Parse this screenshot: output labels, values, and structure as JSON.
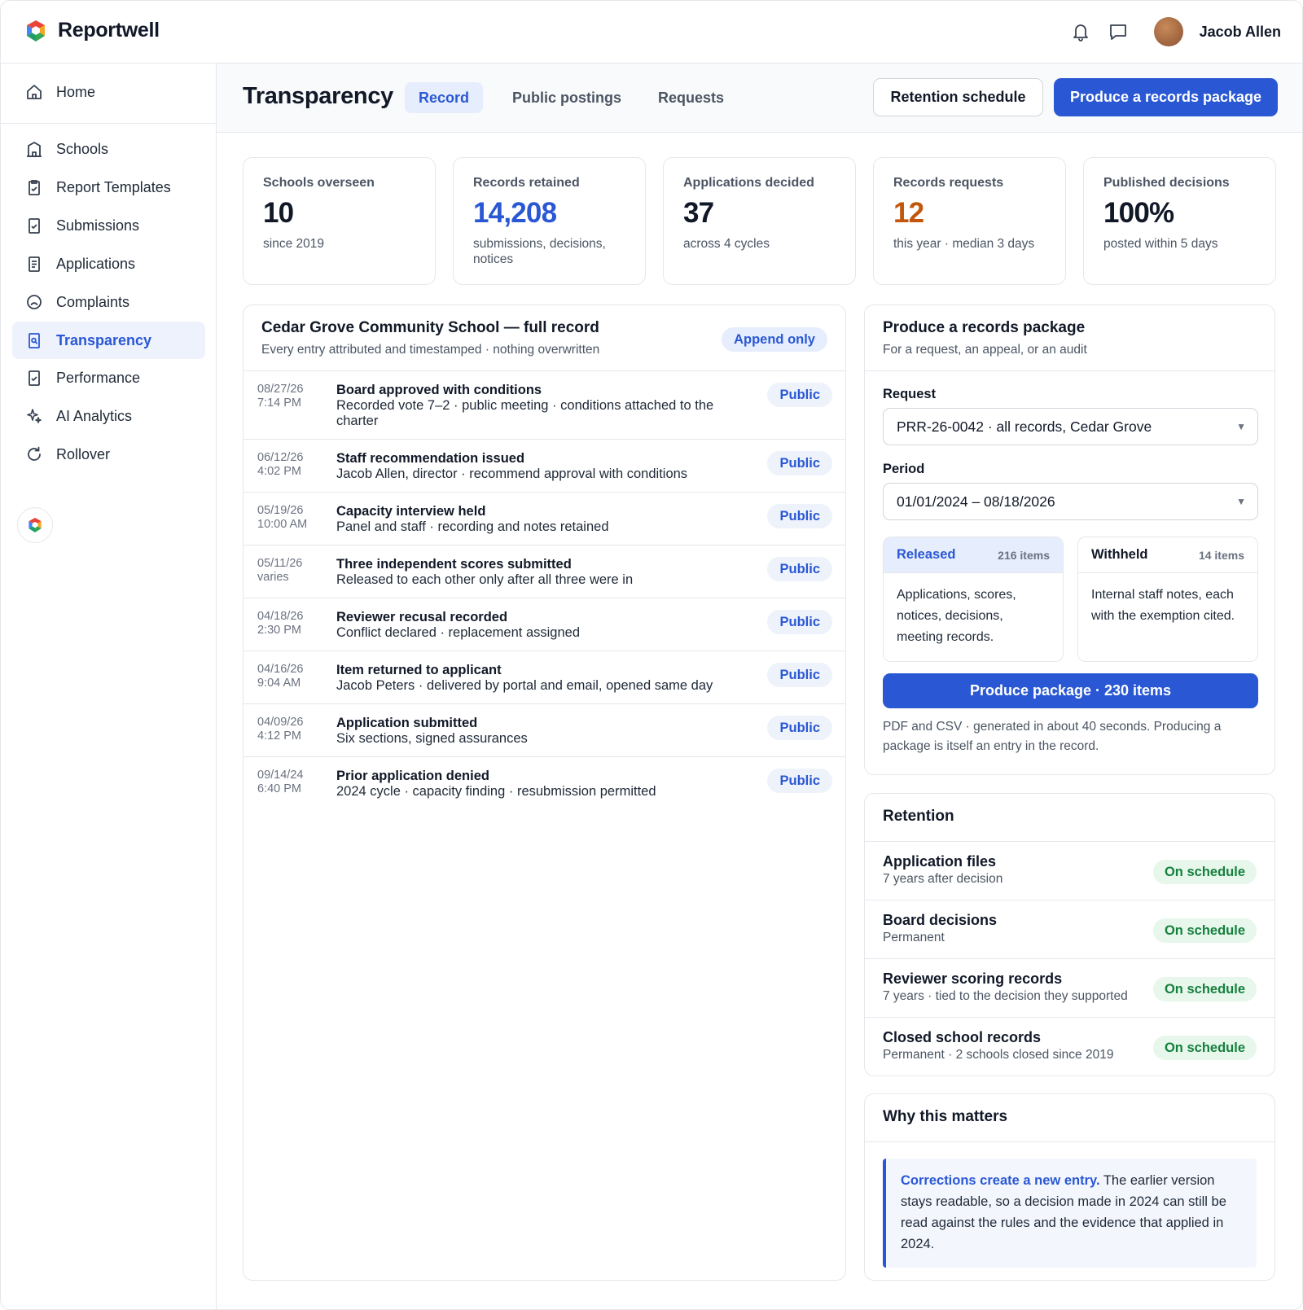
{
  "app": {
    "name": "Reportwell"
  },
  "user": {
    "name": "Jacob Allen"
  },
  "sidebar": {
    "items": [
      {
        "label": "Home",
        "icon": "home-icon"
      },
      {
        "label": "Schools",
        "icon": "building-icon"
      },
      {
        "label": "Report Templates",
        "icon": "clipboard-icon"
      },
      {
        "label": "Submissions",
        "icon": "checkbox-doc-icon"
      },
      {
        "label": "Applications",
        "icon": "document-icon"
      },
      {
        "label": "Complaints",
        "icon": "frown-icon"
      },
      {
        "label": "Transparency",
        "icon": "search-doc-icon",
        "active": true
      },
      {
        "label": "Performance",
        "icon": "checkbox-doc-icon"
      },
      {
        "label": "AI Analytics",
        "icon": "sparkle-icon"
      },
      {
        "label": "Rollover",
        "icon": "refresh-icon"
      }
    ]
  },
  "header": {
    "title": "Transparency",
    "tabs": [
      {
        "label": "Record",
        "active": true
      },
      {
        "label": "Public postings"
      },
      {
        "label": "Requests"
      }
    ],
    "secondary_button": "Retention schedule",
    "primary_button": "Produce a records package"
  },
  "stats": [
    {
      "label": "Schools overseen",
      "value": "10",
      "sub": "since 2019",
      "tone": "default"
    },
    {
      "label": "Records retained",
      "value": "14,208",
      "sub": "submissions, decisions, notices",
      "tone": "blue"
    },
    {
      "label": "Applications decided",
      "value": "37",
      "sub": "across 4 cycles",
      "tone": "default"
    },
    {
      "label": "Records requests",
      "value": "12",
      "sub": "this year · median 3 days",
      "tone": "orange"
    },
    {
      "label": "Published decisions",
      "value": "100%",
      "sub": "posted within 5 days",
      "tone": "default"
    }
  ],
  "record": {
    "title": "Cedar Grove Community School — full record",
    "subtitle": "Every entry attributed and timestamped · nothing overwritten",
    "badge": "Append only",
    "entries": [
      {
        "date": "08/27/26",
        "time": "7:14 PM",
        "title": "Board approved with conditions",
        "desc": "Recorded vote 7–2 · public meeting · conditions attached to the charter",
        "badge": "Public"
      },
      {
        "date": "06/12/26",
        "time": "4:02 PM",
        "title": "Staff recommendation issued",
        "desc": "Jacob Allen, director · recommend approval with conditions",
        "badge": "Public"
      },
      {
        "date": "05/19/26",
        "time": "10:00 AM",
        "title": "Capacity interview held",
        "desc": "Panel and staff · recording and notes retained",
        "badge": "Public"
      },
      {
        "date": "05/11/26",
        "time": "varies",
        "title": "Three independent scores submitted",
        "desc": "Released to each other only after all three were in",
        "badge": "Public"
      },
      {
        "date": "04/18/26",
        "time": "2:30 PM",
        "title": "Reviewer recusal recorded",
        "desc": "Conflict declared · replacement assigned",
        "badge": "Public"
      },
      {
        "date": "04/16/26",
        "time": "9:04 AM",
        "title": "Item returned to applicant",
        "desc": "Jacob Peters · delivered by portal and email, opened same day",
        "badge": "Public"
      },
      {
        "date": "04/09/26",
        "time": "4:12 PM",
        "title": "Application submitted",
        "desc": "Six sections, signed assurances",
        "badge": "Public"
      },
      {
        "date": "09/14/24",
        "time": "6:40 PM",
        "title": "Prior application denied",
        "desc": "2024 cycle · capacity finding · resubmission permitted",
        "badge": "Public"
      }
    ]
  },
  "package": {
    "title": "Produce a records package",
    "subtitle": "For a request, an appeal, or an audit",
    "request_label": "Request",
    "request_value": "PRR-26-0042 · all records, Cedar Grove",
    "period_label": "Period",
    "period_value": "01/01/2024 – 08/18/2026",
    "released": {
      "name": "Released",
      "count": "216 items",
      "body": "Applications, scores, notices, decisions, meeting records."
    },
    "withheld": {
      "name": "Withheld",
      "count": "14 items",
      "body": "Internal staff notes, each with the exemption cited."
    },
    "button": "Produce package · 230 items",
    "note": "PDF and CSV · generated in about 40 seconds. Producing a package is itself an entry in the record."
  },
  "retention": {
    "title": "Retention",
    "rows": [
      {
        "title": "Application files",
        "sub": "7 years after decision",
        "status": "On schedule"
      },
      {
        "title": "Board decisions",
        "sub": "Permanent",
        "status": "On schedule"
      },
      {
        "title": "Reviewer scoring records",
        "sub": "7 years · tied to the decision they supported",
        "status": "On schedule"
      },
      {
        "title": "Closed school records",
        "sub": "Permanent · 2 schools closed since 2019",
        "status": "On schedule"
      }
    ]
  },
  "why": {
    "title": "Why this matters",
    "lead": "Corrections create a new entry.",
    "body": " The earlier version stays readable, so a decision made in 2024 can still be read against the rules and the evidence that applied in 2024."
  },
  "colors": {
    "accent": "#2a58d4",
    "accent_soft": "#e6edfc",
    "warning": "#c2560c",
    "success": "#15803d",
    "success_soft": "#e7f7ec",
    "border": "#e5e7eb"
  }
}
